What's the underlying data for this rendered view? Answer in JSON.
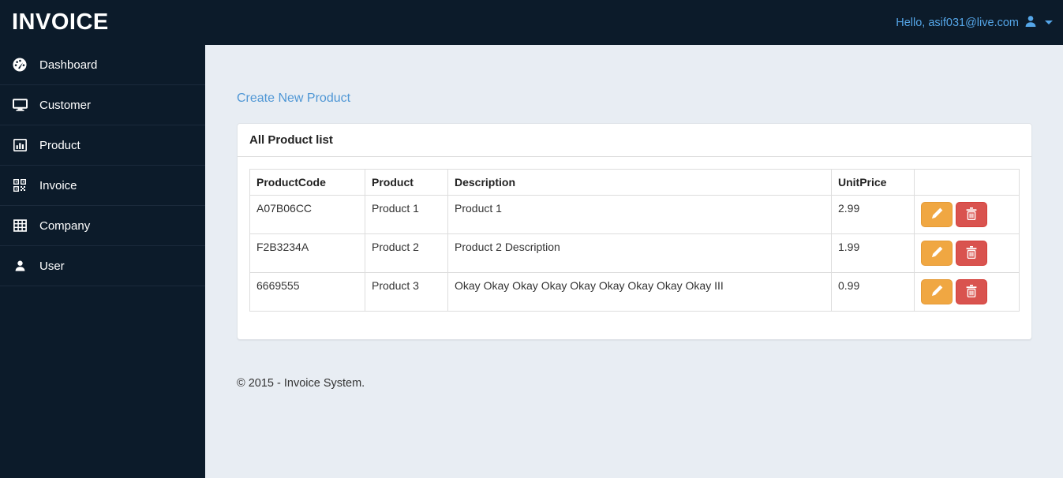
{
  "navbar": {
    "brand": "INVOICE",
    "user_greeting": "Hello, asif031@live.com"
  },
  "sidebar": {
    "items": [
      {
        "label": "Dashboard",
        "icon": "dashboard-gauge-icon"
      },
      {
        "label": "Customer",
        "icon": "desktop-icon"
      },
      {
        "label": "Product",
        "icon": "bar-chart-icon"
      },
      {
        "label": "Invoice",
        "icon": "qrcode-icon"
      },
      {
        "label": "Company",
        "icon": "table-grid-icon"
      },
      {
        "label": "User",
        "icon": "person-icon"
      }
    ]
  },
  "main": {
    "create_link": "Create New Product",
    "panel_title": "All Product list",
    "table": {
      "headers": [
        "ProductCode",
        "Product",
        "Description",
        "UnitPrice",
        ""
      ],
      "rows": [
        {
          "product_code": "A07B06CC",
          "product": "Product 1",
          "description": "Product 1",
          "unit_price": "2.99"
        },
        {
          "product_code": "F2B3234A",
          "product": "Product 2",
          "description": "Product 2 Description",
          "unit_price": "1.99"
        },
        {
          "product_code": "6669555",
          "product": "Product 3",
          "description": "Okay Okay Okay Okay Okay Okay Okay Okay Okay III",
          "unit_price": "0.99"
        }
      ]
    }
  },
  "footer": {
    "copyright": "© 2015 - Invoice System."
  },
  "colors": {
    "navbar_bg": "#0c1b2a",
    "sidebar_bg": "#0c1b2a",
    "content_bg": "#e8edf3",
    "link_blue": "#4f97d5",
    "navbar_link_blue": "#55a6e8",
    "edit_button_bg": "#f0a742",
    "delete_button_bg": "#d9534f",
    "table_border": "#dddddd"
  }
}
